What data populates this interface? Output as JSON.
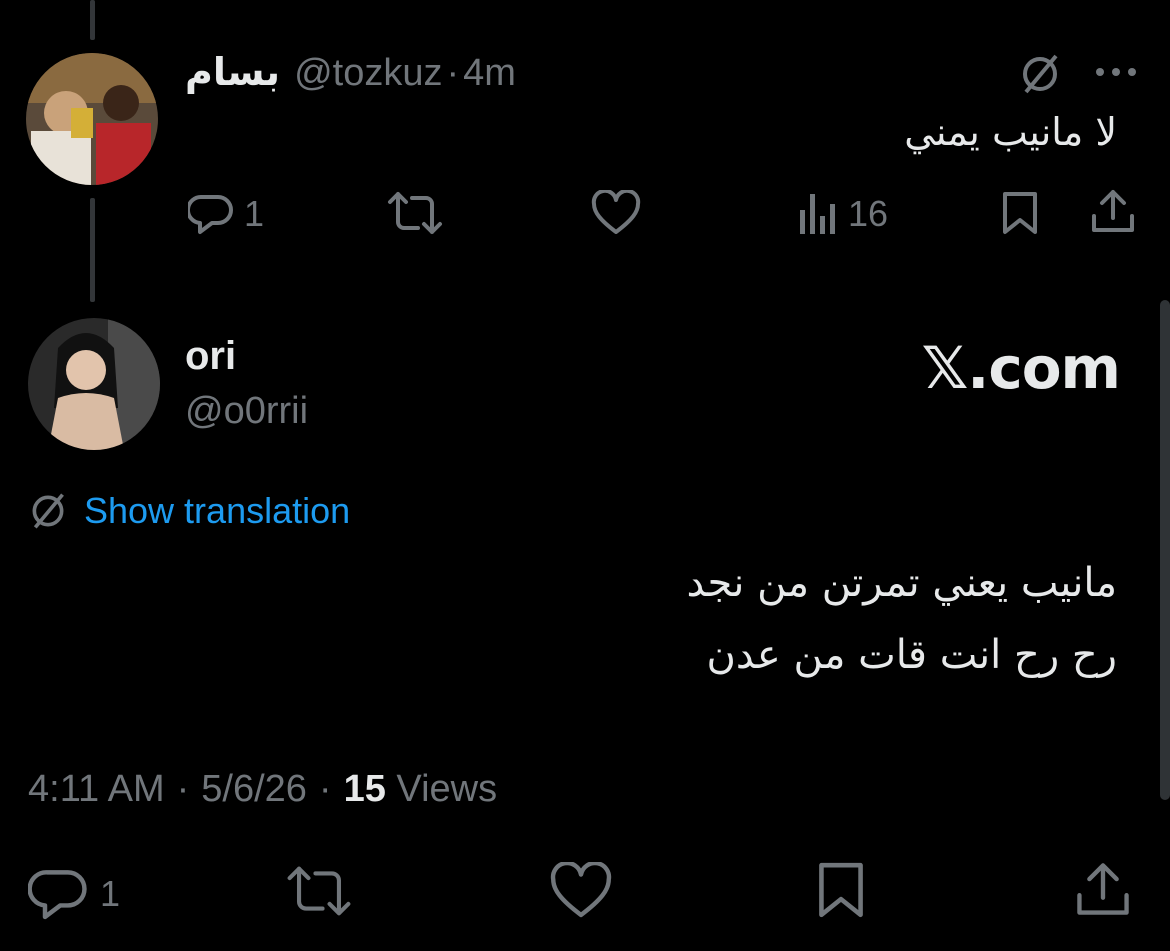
{
  "reply_tweet": {
    "display_name": "بسام",
    "handle": "@tozkuz",
    "separator": "·",
    "time_ago": "4m",
    "text": "لا مانيب يمني",
    "replies_count": "1",
    "views_count": "16"
  },
  "main_tweet": {
    "display_name": "ori",
    "handle": "@o0rrii",
    "watermark": "𝕏.com",
    "show_translation": "Show translation",
    "text_line1": "مانيب يعني تمرتن من نجد",
    "text_line2": "رح رح انت قات من عدن",
    "time": "4:11 AM",
    "sep1": "·",
    "date": "5/6/26",
    "sep2": "·",
    "views_count": "15",
    "views_label": "Views",
    "replies_count": "1"
  }
}
